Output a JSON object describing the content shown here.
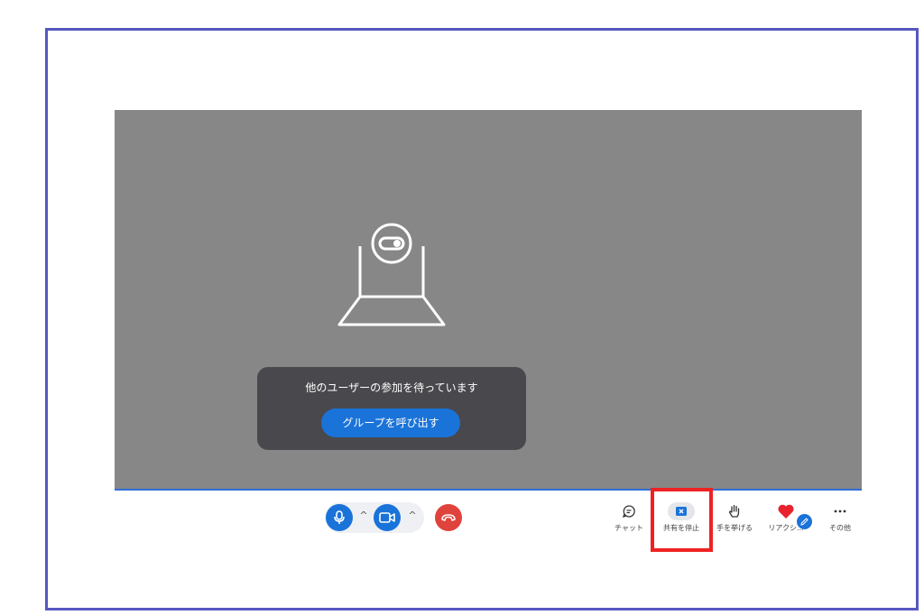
{
  "colors": {
    "frame_border": "#5558c0",
    "stage_bg": "#878787",
    "accent_blue": "#1a73d9",
    "end_call_red": "#e0433c",
    "highlight_red": "#ee2222",
    "card_bg": "#48484d"
  },
  "waiting": {
    "message": "他のユーザーの参加を待っています",
    "call_group_button": "グループを呼び出す"
  },
  "controls": {
    "mic_icon": "microphone-icon",
    "camera_icon": "video-camera-icon",
    "end_call_icon": "hang-up-icon",
    "caret": "^"
  },
  "toolbar": {
    "chat_label": "チャット",
    "stop_share_label": "共有を停止",
    "raise_hand_label": "手を挙げる",
    "reactions_label": "リアクシ...",
    "more_label": "その他"
  }
}
